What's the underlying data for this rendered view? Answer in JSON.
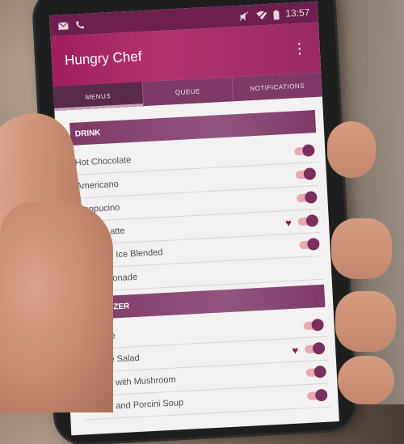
{
  "status_bar": {
    "time": "13:57",
    "icons_left": [
      "mail-icon",
      "phone-icon"
    ],
    "icons_right": [
      "mute-icon",
      "wifi-off-icon",
      "battery-icon"
    ]
  },
  "app_bar": {
    "title": "Hungry Chef",
    "overflow_icon": "more-vert-icon"
  },
  "tabs": [
    {
      "label": "MENUS",
      "active": true
    },
    {
      "label": "QUEUE",
      "active": false
    },
    {
      "label": "NOTIFICATIONS",
      "active": false
    }
  ],
  "sections": [
    {
      "title": "DRINK",
      "items": [
        {
          "name": "Hot Chocolate",
          "favorite": false,
          "enabled": true
        },
        {
          "name": "Americano",
          "favorite": false,
          "enabled": true
        },
        {
          "name": "Cappucino",
          "favorite": false,
          "enabled": true
        },
        {
          "name": "Vanila Latte",
          "favorite": true,
          "enabled": true
        },
        {
          "name": "Caramel Ice Blended",
          "favorite": false,
          "enabled": true
        },
        {
          "name": "Ice Lemonade",
          "favorite": false,
          "enabled": true
        }
      ]
    },
    {
      "title": "APPETIZER",
      "items": [
        {
          "name": "Canape",
          "favorite": false,
          "enabled": true
        },
        {
          "name": "Nicoise Salad",
          "favorite": true,
          "enabled": true
        },
        {
          "name": "Ravioli with Mushroom",
          "favorite": false,
          "enabled": true
        },
        {
          "name": "Potato and Porcini Soup",
          "favorite": false,
          "enabled": true
        }
      ]
    }
  ],
  "colors": {
    "primary": "#9e1f5c",
    "section_header": "#7e3a66",
    "toggle_track": "#e8a9b1",
    "toggle_thumb": "#7b2f5e"
  }
}
